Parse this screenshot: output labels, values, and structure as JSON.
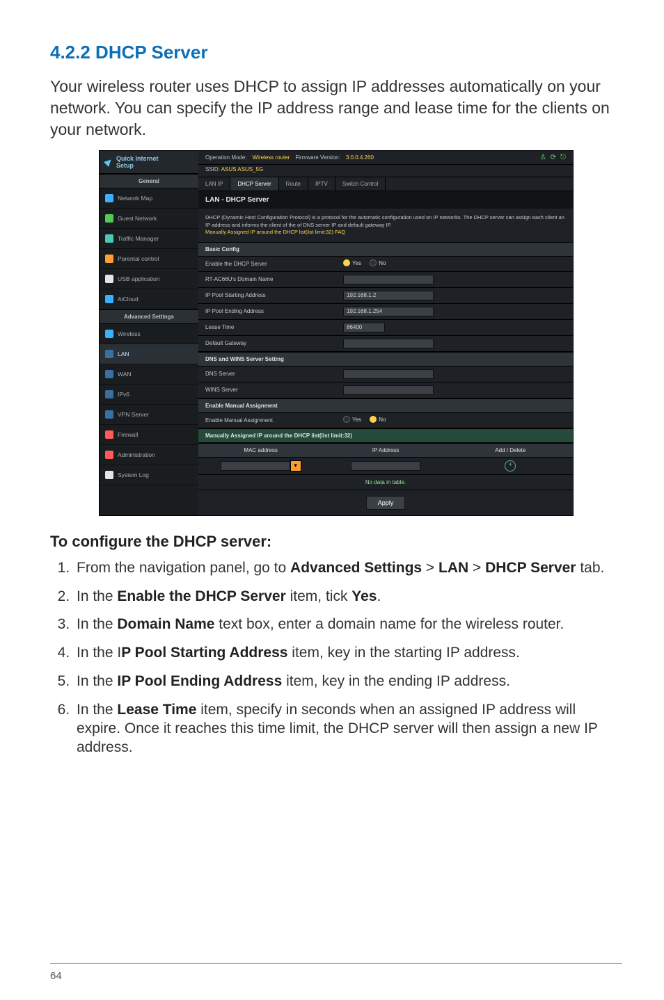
{
  "section_heading": "4.2.2 DHCP Server",
  "intro_text": "Your wireless router uses DHCP to assign IP addresses automatically on your network. You can specify the IP address range and lease time for the clients on your network.",
  "router": {
    "quick": {
      "l1": "Quick Internet",
      "l2": "Setup"
    },
    "side_general": "General",
    "side_adv": "Advanced Settings",
    "side_general_items": [
      "Network Map",
      "Guest Network",
      "Traffic Manager",
      "Parental control",
      "USB application",
      "AiCloud"
    ],
    "side_adv_items": [
      "Wireless",
      "LAN",
      "WAN",
      "IPv6",
      "VPN Server",
      "Firewall",
      "Administration",
      "System Log"
    ],
    "top": {
      "op_label": "Operation Mode:",
      "op_value": "Wireless router",
      "fw_label": "Firmware Version:",
      "fw_value": "3.0.0.4.260",
      "ssid_label": "SSID:",
      "ssid_value": "ASUS ASUS_5G"
    },
    "tabs": [
      "LAN IP",
      "DHCP Server",
      "Route",
      "IPTV",
      "Switch Control"
    ],
    "panel_title": "LAN - DHCP Server",
    "panel_desc": "DHCP (Dynamic Host Configuration Protocol) is a protocol for the automatic configuration used on IP networks. The DHCP server can assign each client an IP address and informs the client of the of DNS server IP and default gateway IP.",
    "panel_faq": "Manually Assigned IP around the DHCP list(list limit:32) FAQ",
    "band_basic": "Basic Config",
    "rows": {
      "enable_label": "Enable the DHCP Server",
      "enable_yes": "Yes",
      "enable_no": "No",
      "domain_label": "RT-AC66U's Domain Name",
      "start_label": "IP Pool Starting Address",
      "start_val": "192.168.1.2",
      "end_label": "IP Pool Ending Address",
      "end_val": "192.168.1.254",
      "lease_label": "Lease Time",
      "lease_val": "86400",
      "gw_label": "Default Gateway"
    },
    "band_dns": "DNS and WINS Server Setting",
    "dns_label": "DNS Server",
    "wins_label": "WINS Server",
    "band_manual": "Enable Manual Assignment",
    "manual_label": "Enable Manual Assignment",
    "manual_yes": "Yes",
    "manual_no": "No",
    "band_table": "Manually Assigned IP around the DHCP list(list limit:32)",
    "th_mac": "MAC address",
    "th_ip": "IP Address",
    "th_action": "Add / Delete",
    "nodata": "No data in table.",
    "apply": "Apply"
  },
  "config_heading": "To configure the DHCP server:",
  "steps": {
    "s1a": "From the navigation panel, go to ",
    "s1b": "Advanced Settings",
    "s1c": " > ",
    "s1d": "LAN",
    "s1e": " > ",
    "s1f": "DHCP Server",
    "s1g": " tab.",
    "s2a": "In the ",
    "s2b": "Enable the DHCP Server",
    "s2c": " item, tick ",
    "s2d": "Yes",
    "s2e": ".",
    "s3a": "In the ",
    "s3b": "Domain Name",
    "s3c": " text box, enter a domain name for the wireless router.",
    "s4a": "In the I",
    "s4b": "P Pool Starting Address",
    "s4c": " item, key in the starting IP address.",
    "s5a": "In the ",
    "s5b": "IP Pool Ending Address",
    "s5c": " item, key in the ending IP address.",
    "s6a": "In the ",
    "s6b": "Lease Time",
    "s6c": " item, specify in seconds when an assigned IP address will expire. Once it reaches this time limit, the DHCP server will then assign a new IP address."
  },
  "page_number": "64"
}
